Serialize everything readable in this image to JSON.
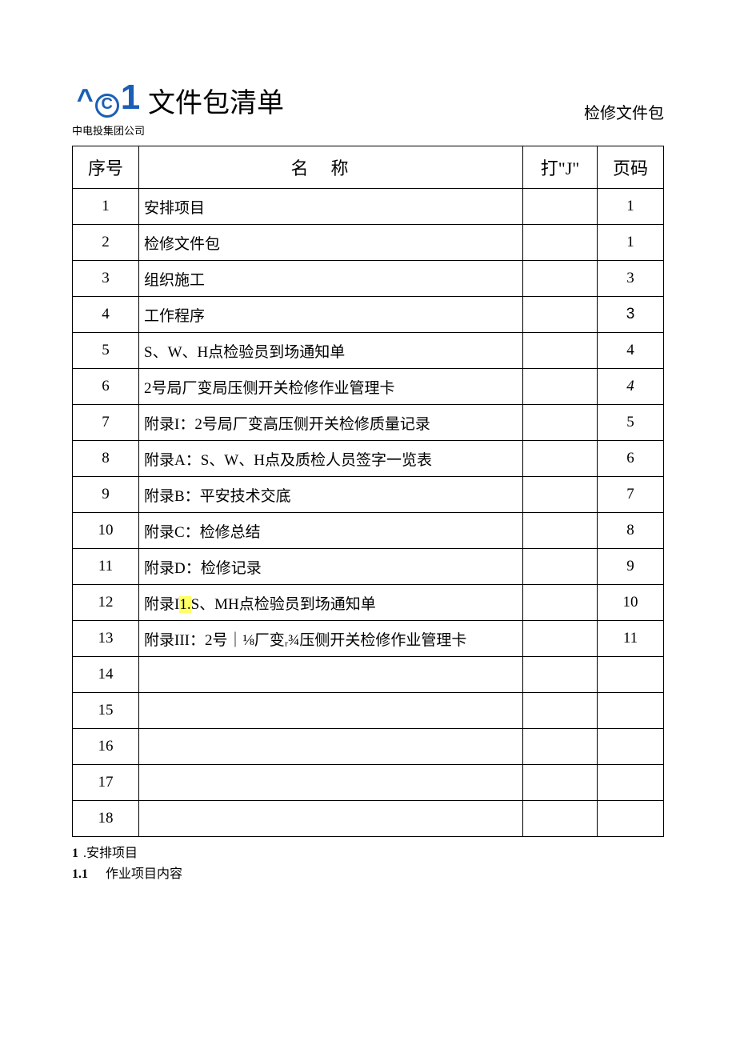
{
  "header": {
    "logo_caret": "^",
    "logo_c": "C",
    "logo_1": "1",
    "company": "中电投集团公司",
    "title": "文件包清单",
    "right_label": "检修文件包"
  },
  "table": {
    "headers": {
      "seq": "序号",
      "name": "名称",
      "check": "打\"J\"",
      "page": "页码"
    },
    "rows": [
      {
        "seq": "1",
        "name": "安排项目",
        "check": "",
        "page": "1"
      },
      {
        "seq": "2",
        "name": "检修文件包",
        "check": "",
        "page": "1"
      },
      {
        "seq": "3",
        "name": "组织施工",
        "check": "",
        "page": "3"
      },
      {
        "seq": "4",
        "name": "工作程序",
        "check": "",
        "page": "3",
        "page_class": "sans3"
      },
      {
        "seq": "5",
        "name": "S、W、H点检验员到场通知单",
        "check": "",
        "page": "4"
      },
      {
        "seq": "6",
        "name": "2号局厂变局压侧开关检修作业管理卡",
        "check": "",
        "page": "4",
        "page_class": "italic"
      },
      {
        "seq": "7",
        "name": "附录I：2号局厂变高压侧开关检修质量记录",
        "check": "",
        "page": "5"
      },
      {
        "seq": "8",
        "name": "附录A：S、W、H点及质检人员签字一览表",
        "check": "",
        "page": "6"
      },
      {
        "seq": "9",
        "name": "附录B：平安技术交底",
        "check": "",
        "page": "7"
      },
      {
        "seq": "10",
        "name": "附录C：检修总结",
        "check": "",
        "page": "8"
      },
      {
        "seq": "11",
        "name": "附录D：检修记录",
        "check": "",
        "page": "9"
      },
      {
        "seq": "12",
        "name_pre": "附录I",
        "name_hl": "1.",
        "name_post": "S、MH点检验员到场通知单",
        "check": "",
        "page": "10"
      },
      {
        "seq": "13",
        "name": "附录III：2号｜⅛厂变ᵣ¾压侧开关检修作业管理卡",
        "check": "",
        "page": "11"
      },
      {
        "seq": "14",
        "name": "",
        "check": "",
        "page": ""
      },
      {
        "seq": "15",
        "name": "",
        "check": "",
        "page": ""
      },
      {
        "seq": "16",
        "name": "",
        "check": "",
        "page": ""
      },
      {
        "seq": "17",
        "name": "",
        "check": "",
        "page": ""
      },
      {
        "seq": "18",
        "name": "",
        "check": "",
        "page": ""
      }
    ]
  },
  "footer": {
    "line1_num": "1",
    "line1_text": ".安排项目",
    "line2_num": "1.1",
    "line2_text": "作业项目内容"
  }
}
